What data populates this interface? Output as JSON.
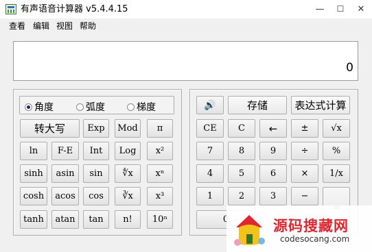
{
  "window": {
    "title": "有声语音计算器 v5.4.4.15",
    "min": "—",
    "max": "☐",
    "close": "✕"
  },
  "menu": [
    "查看",
    "编辑",
    "视图",
    "帮助"
  ],
  "display": {
    "value": "0"
  },
  "angle_modes": [
    {
      "label": "角度",
      "selected": true
    },
    {
      "label": "弧度",
      "selected": false
    },
    {
      "label": "梯度",
      "selected": false
    }
  ],
  "scientific": {
    "to_upper": "转大写",
    "exp": "Exp",
    "mod": "Mod",
    "pi": "π",
    "ln": "ln",
    "fe": "F-E",
    "int": "Int",
    "log": "Log",
    "x2": "x²",
    "sinh": "sinh",
    "asin": "asin",
    "sin": "sin",
    "root4": "∜x",
    "xn": "xⁿ",
    "cosh": "cosh",
    "acos": "acos",
    "cos": "cos",
    "root3": "∛x",
    "x3": "x³",
    "tanh": "tanh",
    "atan": "atan",
    "tan": "tan",
    "fact": "n!",
    "ten_n": "10ⁿ"
  },
  "standard": {
    "sound": "🔊",
    "store": "存储",
    "expr": "表达式计算",
    "ce": "CE",
    "c": "C",
    "back": "←",
    "pm": "±",
    "sqrt": "√x",
    "d7": "7",
    "d8": "8",
    "d9": "9",
    "div": "÷",
    "pct": "%",
    "d4": "4",
    "d5": "5",
    "d6": "6",
    "mul": "×",
    "recip": "1/x",
    "d1": "1",
    "d2": "2",
    "d3": "3",
    "minus": "−",
    "eq": "=",
    "d0": "0"
  },
  "watermark": {
    "name": "源码搜藏网",
    "url": "codesocang.com",
    "brand_color": "#e0262f"
  }
}
